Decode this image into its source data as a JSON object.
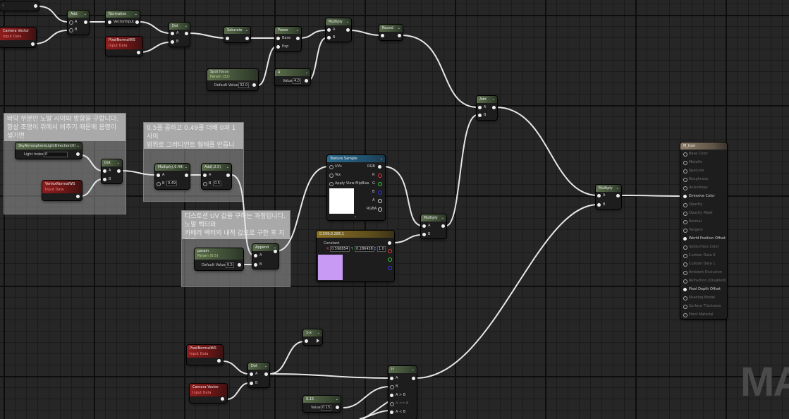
{
  "comments": {
    "c1": "바닥 부분만 노말 시야와 방향을 구합니다.\n항상 조명이 위에서 비추기 때문에 음영이 생기면\n바닥면으로 계산합니다.",
    "c2": "0.5를 곱하고 0.49를 더해 0과 1사이\n범위로 그라디언트 형태를 만듭니다.",
    "c3": "디스토션 UV 값을 구하는 과정입니다. 노말 벡터와\n카메라 벡터의 내적 값으로 구한 후 지정된\n범위로 보정합니다."
  },
  "nodes": {
    "add1": {
      "title": "Add",
      "a": "A",
      "b": "B"
    },
    "normalize": {
      "title": "Normalize",
      "in": "VectorInput"
    },
    "camera_vector_top": {
      "title": "Camera Vector",
      "sub": "Input Data"
    },
    "pixel_normal_top": {
      "title": "PixelNormalWS",
      "sub": "Input Data"
    },
    "dot1": {
      "title": "Dot",
      "a": "A",
      "b": "B"
    },
    "saturate": {
      "title": "Saturate"
    },
    "power": {
      "title": "Power",
      "base": "Base",
      "exp": "Exp"
    },
    "multiply_top": {
      "title": "Multiply",
      "a": "A",
      "b": "B"
    },
    "round": {
      "title": "Round"
    },
    "spot_focus": {
      "title": "Spot focus",
      "sub": "Param (32)",
      "label": "Default Value",
      "value": "32.0"
    },
    "const4": {
      "title": "4",
      "label": "Value",
      "value": "4.0"
    },
    "add2": {
      "title": "Add",
      "a": "A",
      "b": "B"
    },
    "sky_light": {
      "title": "SkyAtmosphereLightDirection(0)",
      "label": "Light Index",
      "value": "0"
    },
    "vertex_normal": {
      "title": "VertexNormalWS",
      "sub": "Input Data"
    },
    "dot2": {
      "title": "Dot",
      "a": "A",
      "b": "B"
    },
    "multiply_049": {
      "title": "Multiply(,0.49)",
      "a": "A",
      "b": "B",
      "bval": "0.49"
    },
    "add_05": {
      "title": "Add(,0.5)",
      "a": "A",
      "b": "B",
      "bval": "0.5"
    },
    "texture_sample": {
      "title": "Texture Sample",
      "uvs": "UVs",
      "tex": "Tex",
      "mip": "Apply View MipBias",
      "rgb": "RGB",
      "r": "R",
      "g": "G",
      "bch": "B",
      "a": "A",
      "rgba": "RGBA"
    },
    "const3": {
      "title": "0.599,0.286,1",
      "label": "Constant",
      "x": "X",
      "xv": "0.598854",
      "y": "Y",
      "yv": "0.286458",
      "z": "Z",
      "zv": "1.0",
      "swatch": "#c89af3"
    },
    "multiply_mid": {
      "title": "Multiply",
      "a": "A",
      "b": "B"
    },
    "append": {
      "title": "Append",
      "a": "A",
      "b": "B"
    },
    "param": {
      "title": "param",
      "sub": "Param (0.5)",
      "label": "Default Value",
      "value": "0.5"
    },
    "multiply_right": {
      "title": "Multiply",
      "a": "A",
      "b": "B"
    },
    "const_1x": {
      "title": "1-x"
    },
    "pixel_normal_bot": {
      "title": "PixelNormalWS",
      "sub": "Input Data"
    },
    "camera_vector_bot": {
      "title": "Camera Vector",
      "sub": "Input Data"
    },
    "dot3": {
      "title": "Dot",
      "a": "A",
      "b": "B"
    },
    "if_node": {
      "title": "If",
      "a": "A",
      "b": "B",
      "agb": "A > B",
      "aeb": "A == B",
      "alb": "A < B"
    },
    "const015": {
      "title": "0.15",
      "label": "Value",
      "value": "0.15"
    }
  },
  "material": {
    "title": "M_Icon",
    "inputs": [
      {
        "label": "Base Color",
        "active": false
      },
      {
        "label": "Metallic",
        "active": false
      },
      {
        "label": "Specular",
        "active": false
      },
      {
        "label": "Roughness",
        "active": false
      },
      {
        "label": "Anisotropy",
        "active": false
      },
      {
        "label": "Emissive Color",
        "active": true
      },
      {
        "label": "Opacity",
        "active": false
      },
      {
        "label": "Opacity Mask",
        "active": false
      },
      {
        "label": "Normal",
        "active": false
      },
      {
        "label": "Tangent",
        "active": false
      },
      {
        "label": "World Position Offset",
        "active": true
      },
      {
        "label": "Subsurface Color",
        "active": false
      },
      {
        "label": "Custom Data 0",
        "active": false
      },
      {
        "label": "Custom Data 1",
        "active": false
      },
      {
        "label": "Ambient Occlusion",
        "active": false
      },
      {
        "label": "Refraction (Disabled)",
        "active": false
      },
      {
        "label": "Pixel Depth Offset",
        "active": true
      },
      {
        "label": "Shading Model",
        "active": false
      },
      {
        "label": "Surface Thickness",
        "active": false
      },
      {
        "label": "Front Material",
        "active": false
      }
    ]
  },
  "watermark": "MA"
}
